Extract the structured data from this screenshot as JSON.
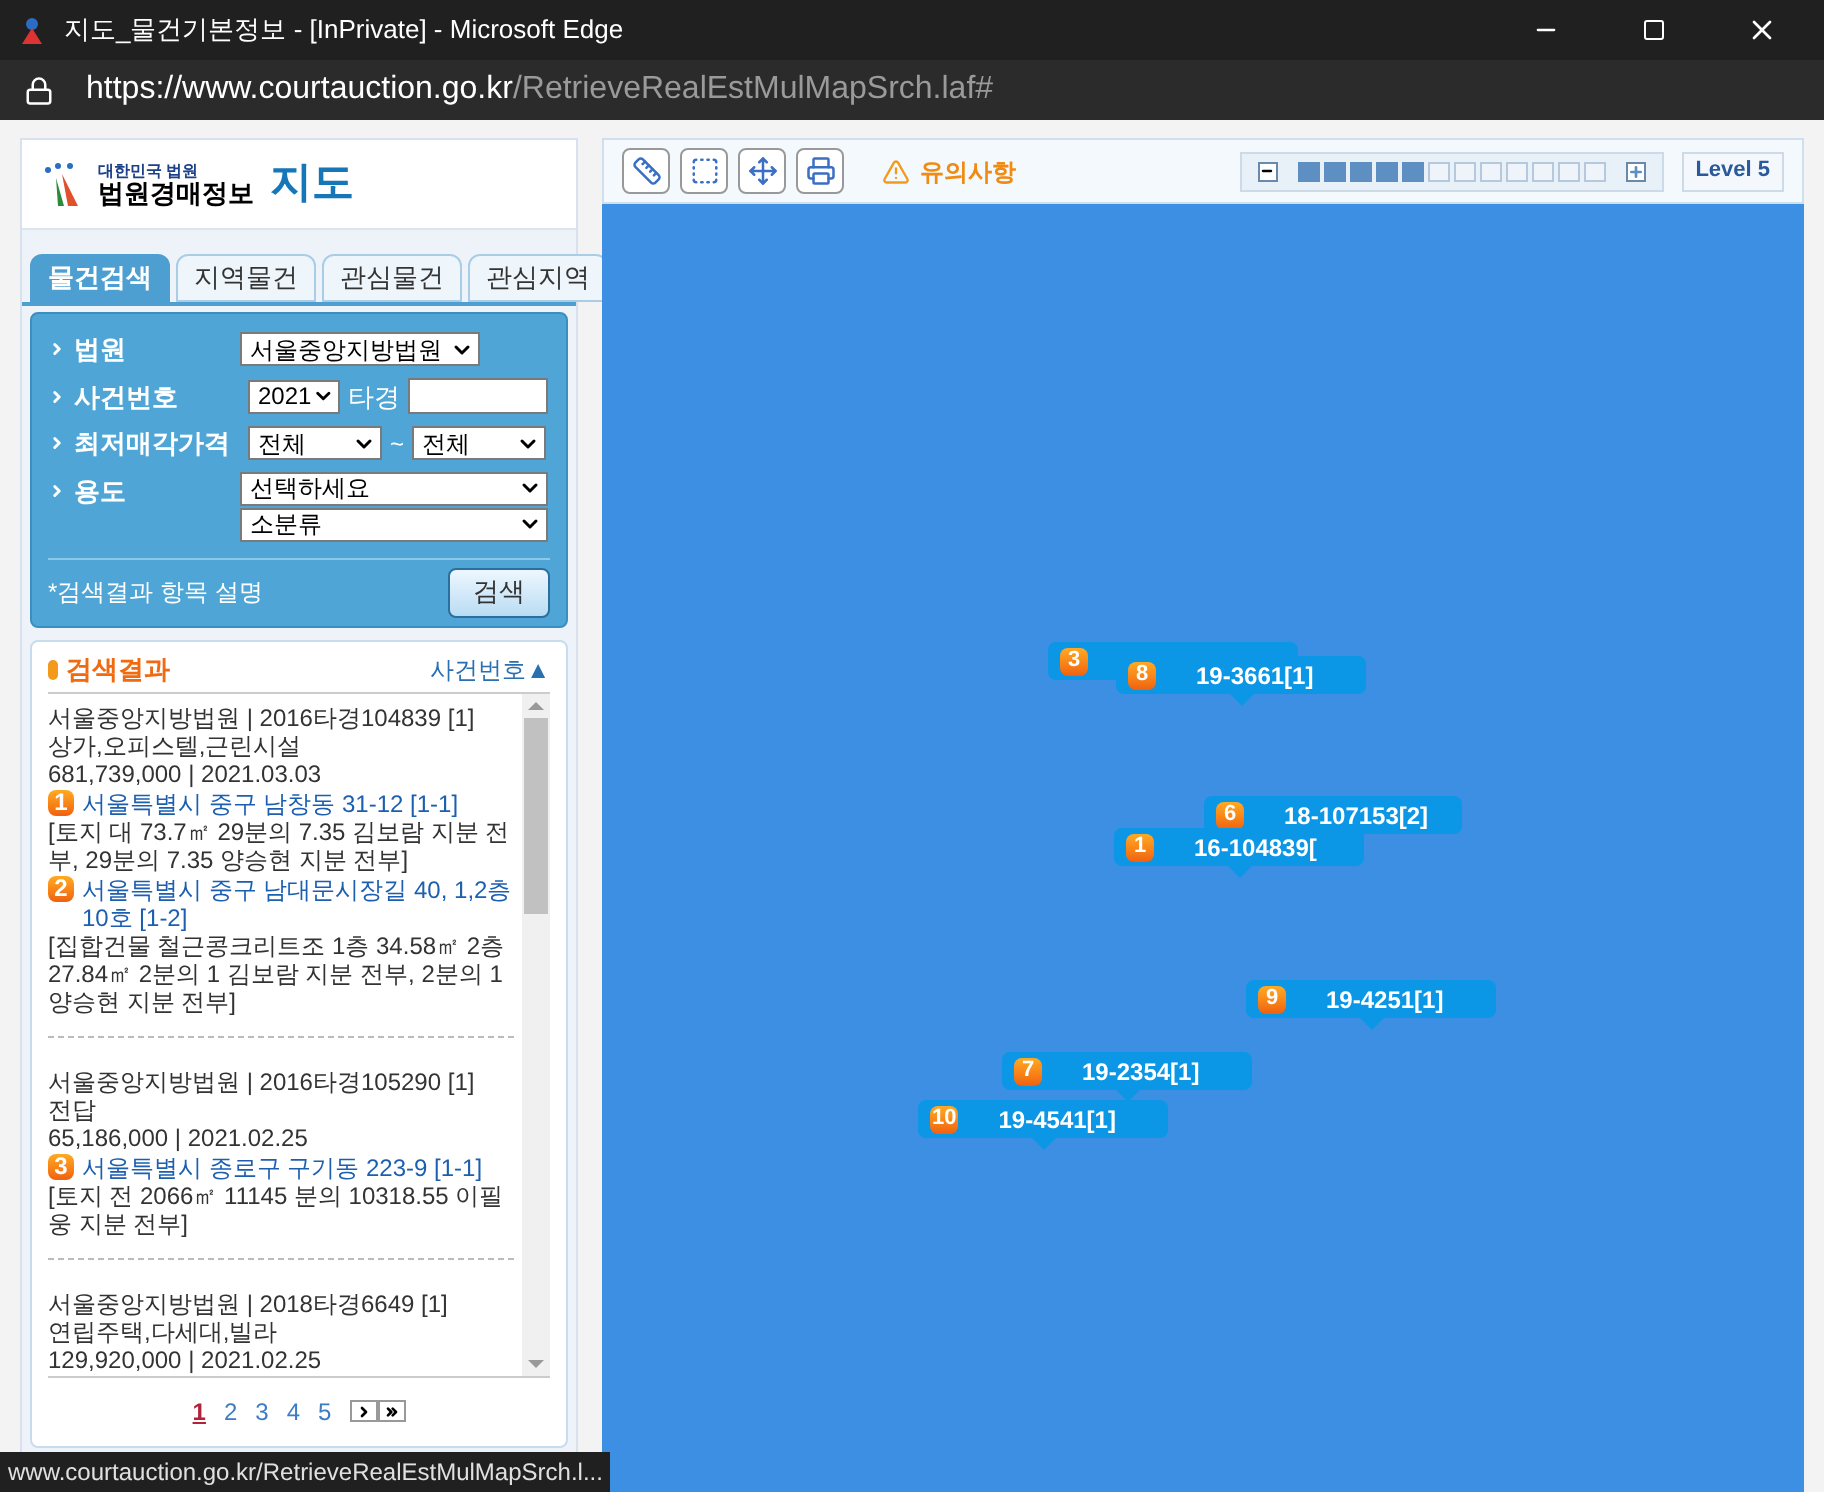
{
  "window": {
    "title": "지도_물건기본정보 - [InPrivate] - Microsoft Edge"
  },
  "address_bar": {
    "host": "https://www.courtauction.go.kr",
    "path": "/RetrieveRealEstMulMapSrch.laf#"
  },
  "logo": {
    "subtitle": "대한민국 법원",
    "name": "법원경매정보",
    "page": "지도"
  },
  "tabs": [
    {
      "label": "물건검색",
      "selected": true
    },
    {
      "label": "지역물건",
      "selected": false
    },
    {
      "label": "관심물건",
      "selected": false
    },
    {
      "label": "관심지역",
      "selected": false
    }
  ],
  "search": {
    "court": {
      "label": "법원",
      "value": "서울중앙지방법원"
    },
    "case": {
      "label": "사건번호",
      "year": "2021",
      "type": "타경"
    },
    "price": {
      "label": "최저매각가격",
      "from": "전체",
      "sep": "~",
      "to": "전체"
    },
    "usage": {
      "label": "용도",
      "main": "선택하세요",
      "sub": "소분류"
    },
    "help": "*검색결과 항목 설명",
    "button": "검색"
  },
  "results": {
    "title": "검색결과",
    "sort": "사건번호▲",
    "items": [
      {
        "case": "서울중앙지방법원 | 2016타경104839 [1]",
        "usage": "상가,오피스텔,근린시설",
        "price": "681,739,000 | 2021.03.03",
        "addresses": [
          {
            "no": "1",
            "address": "서울특별시 중구 남창동 31-12 [1-1]",
            "detail": "[토지 대 73.7㎡ 29분의 7.35 김보람 지분 전부, 29분의 7.35 양승현 지분 전부]"
          },
          {
            "no": "2",
            "address": "서울특별시 중구 남대문시장길 40, 1,2층10호 [1-2]",
            "detail": "[집합건물 철근콩크리트조 1층 34.58㎡ 2층 27.84㎡ 2분의 1 김보람 지분 전부, 2분의 1 양승현 지분 전부]"
          }
        ]
      },
      {
        "case": "서울중앙지방법원 | 2016타경105290 [1]",
        "usage": "전답",
        "price": "65,186,000 | 2021.02.25",
        "addresses": [
          {
            "no": "3",
            "address": "서울특별시 종로구 구기동 223-9 [1-1]",
            "detail": "[토지 전 2066㎡ 11145 분의 10318.55 이필웅 지분 전부]"
          }
        ]
      },
      {
        "case": "서울중앙지방법원 | 2018타경6649 [1]",
        "usage": "연립주택,다세대,빌라",
        "price": "129,920,000 | 2021.02.25"
      }
    ],
    "pages": [
      {
        "label": "1",
        "selected": true
      },
      {
        "label": "2",
        "selected": false
      },
      {
        "label": "3",
        "selected": false
      },
      {
        "label": "4",
        "selected": false
      },
      {
        "label": "5",
        "selected": false
      }
    ]
  },
  "map_toolbar": {
    "notice": "유의사항",
    "zoom": {
      "level": 0.417
    },
    "level_label": "Level 5"
  },
  "markers": [
    {
      "no": "3"
    },
    {
      "no": "8",
      "label": "19-3661[1]"
    },
    {
      "no": "6",
      "label": "18-107153[2]"
    },
    {
      "no": "1",
      "label": "16-104839["
    },
    {
      "no": "9",
      "label": "19-4251[1]"
    },
    {
      "no": "7",
      "label": "19-2354[1]"
    },
    {
      "no": "10",
      "label": "19-4541[1]"
    }
  ],
  "status_bar": "www.courtauction.go.kr/RetrieveRealEstMulMapSrch.l..."
}
